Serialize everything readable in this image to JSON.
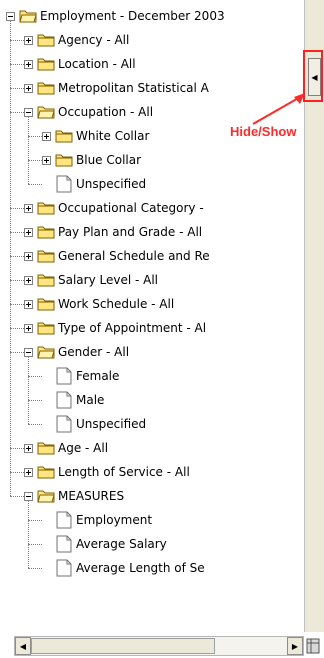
{
  "tree": [
    {
      "label": "Employment - December 2003",
      "level": 0,
      "expanded": true,
      "has_children": true,
      "type": "folder"
    },
    {
      "label": "Agency - All",
      "level": 1,
      "expanded": false,
      "has_children": true,
      "type": "folder"
    },
    {
      "label": "Location - All",
      "level": 1,
      "expanded": false,
      "has_children": true,
      "type": "folder"
    },
    {
      "label": "Metropolitan Statistical A",
      "level": 1,
      "expanded": false,
      "has_children": true,
      "type": "folder"
    },
    {
      "label": "Occupation - All",
      "level": 1,
      "expanded": true,
      "has_children": true,
      "type": "folder"
    },
    {
      "label": "White Collar",
      "level": 2,
      "expanded": false,
      "has_children": true,
      "type": "folder"
    },
    {
      "label": "Blue Collar",
      "level": 2,
      "expanded": false,
      "has_children": true,
      "type": "folder"
    },
    {
      "label": "Unspecified",
      "level": 2,
      "expanded": false,
      "has_children": false,
      "type": "doc"
    },
    {
      "label": "Occupational Category -",
      "level": 1,
      "expanded": false,
      "has_children": true,
      "type": "folder"
    },
    {
      "label": "Pay Plan and Grade - All",
      "level": 1,
      "expanded": false,
      "has_children": true,
      "type": "folder"
    },
    {
      "label": "General Schedule and Re",
      "level": 1,
      "expanded": false,
      "has_children": true,
      "type": "folder"
    },
    {
      "label": "Salary Level - All",
      "level": 1,
      "expanded": false,
      "has_children": true,
      "type": "folder"
    },
    {
      "label": "Work Schedule - All",
      "level": 1,
      "expanded": false,
      "has_children": true,
      "type": "folder"
    },
    {
      "label": "Type of Appointment - Al",
      "level": 1,
      "expanded": false,
      "has_children": true,
      "type": "folder"
    },
    {
      "label": "Gender - All",
      "level": 1,
      "expanded": true,
      "has_children": true,
      "type": "folder"
    },
    {
      "label": "Female",
      "level": 2,
      "expanded": false,
      "has_children": false,
      "type": "doc"
    },
    {
      "label": "Male",
      "level": 2,
      "expanded": false,
      "has_children": false,
      "type": "doc"
    },
    {
      "label": "Unspecified",
      "level": 2,
      "expanded": false,
      "has_children": false,
      "type": "doc"
    },
    {
      "label": "Age - All",
      "level": 1,
      "expanded": false,
      "has_children": true,
      "type": "folder"
    },
    {
      "label": "Length of Service - All",
      "level": 1,
      "expanded": false,
      "has_children": true,
      "type": "folder"
    },
    {
      "label": "MEASURES",
      "level": 1,
      "expanded": true,
      "has_children": true,
      "type": "folder"
    },
    {
      "label": "Employment",
      "level": 2,
      "expanded": false,
      "has_children": false,
      "type": "doc"
    },
    {
      "label": "Average Salary",
      "level": 2,
      "expanded": false,
      "has_children": false,
      "type": "doc"
    },
    {
      "label": "Average Length of Se",
      "level": 2,
      "expanded": false,
      "has_children": false,
      "type": "doc"
    }
  ],
  "annotation": {
    "label": "Hide/Show",
    "color": "#ff2a2a"
  },
  "colors": {
    "folder_fill": "#ffe680",
    "folder_stroke": "#806000",
    "line": "#808080"
  }
}
